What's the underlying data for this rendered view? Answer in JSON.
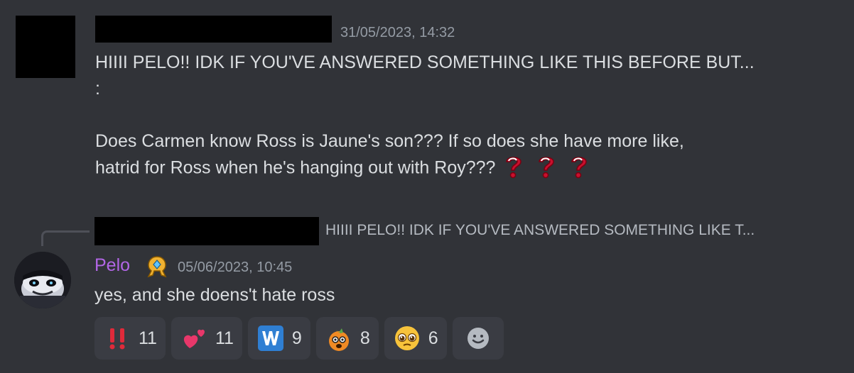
{
  "message1": {
    "timestamp": "31/05/2023, 14:32",
    "lines": [
      "HIIII PELO!! IDK IF YOU'VE ANSWERED SOMETHING LIKE THIS BEFORE BUT...",
      ":",
      "",
      "Does Carmen know Ross is Jaune's son??? If so does she have more like,",
      "hatrid for Ross when he's hanging out with Roy???"
    ],
    "trailing_emoji": "red-question-mark-emoji"
  },
  "reply": {
    "preview": "HIIII PELO!! IDK IF YOU'VE ANSWERED SOMETHING LIKE T..."
  },
  "message2": {
    "author": "Pelo",
    "author_color": "#b266e6",
    "badge_icon": "hypesquad-badge-icon",
    "timestamp": "05/06/2023, 10:45",
    "text": "yes, and she doens't hate ross"
  },
  "reactions": [
    {
      "icon": "double-exclamation-icon",
      "count": "11"
    },
    {
      "icon": "two-hearts-icon",
      "count": "11"
    },
    {
      "icon": "w-letter-icon",
      "count": "9"
    },
    {
      "icon": "orange-character-icon",
      "count": "8"
    },
    {
      "icon": "pleading-face-icon",
      "count": "6"
    },
    {
      "icon": "add-reaction-icon",
      "count": ""
    }
  ],
  "colors": {
    "background": "#313338",
    "text": "#dbdee1",
    "muted": "#949ba4",
    "reaction_bg": "#3a3c43"
  }
}
